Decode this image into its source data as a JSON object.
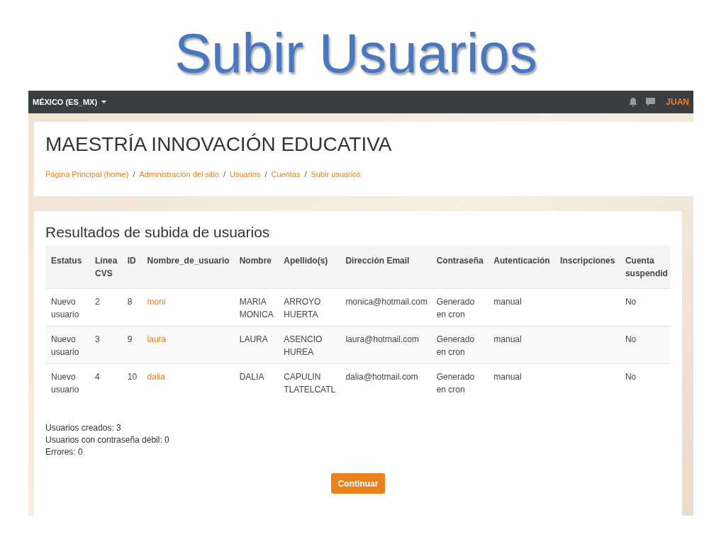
{
  "slide_title": "Subir Usuarios",
  "navbar": {
    "language": "MÉXICO (ES_MX)",
    "user": "JUAN"
  },
  "header": {
    "title": "MAESTRÍA INNOVACIÓN EDUCATIVA",
    "separator": "/",
    "breadcrumb": [
      "Página Principal (home)",
      "Administración del sitio",
      "Usuarios",
      "Cuentas",
      "Subir usuarios"
    ]
  },
  "results": {
    "heading": "Resultados de subida de usuarios",
    "columns": [
      {
        "label": "Estatus",
        "kind": "text"
      },
      {
        "label": "Línea CVS",
        "kind": "text"
      },
      {
        "label": "ID",
        "kind": "text"
      },
      {
        "label": "Nombre_de_usuario",
        "kind": "link"
      },
      {
        "label": "Nombre",
        "kind": "text"
      },
      {
        "label": "Apellido(s)",
        "kind": "text"
      },
      {
        "label": "Dirección Email",
        "kind": "text"
      },
      {
        "label": "Contraseña",
        "kind": "text"
      },
      {
        "label": "Autenticación",
        "kind": "text"
      },
      {
        "label": "Inscripciones",
        "kind": "text"
      },
      {
        "label": "Cuenta suspendid",
        "kind": "text"
      }
    ],
    "rows": [
      [
        "Nuevo usuario",
        "2",
        "8",
        "moni",
        "MARIA MONICA",
        "ARROYO HUERTA",
        "monica@hotmail.com",
        "Generado en cron",
        "manual",
        "",
        "No"
      ],
      [
        "Nuevo usuario",
        "3",
        "9",
        "laura",
        "LAURA",
        "ASENCIO HUREA",
        "laura@hotmail.com",
        "Generado en cron",
        "manual",
        "",
        "No"
      ],
      [
        "Nuevo usuario",
        "4",
        "10",
        "dalia",
        "DALIA",
        "CAPULIN TLATELCATL",
        "dalia@hotmail.com",
        "Generado en cron",
        "manual",
        "",
        "No"
      ]
    ]
  },
  "summary": [
    "Usuarios creados: 3",
    "Usuarios con contraseña débil: 0",
    "Errores: 0"
  ],
  "button": "Continuar"
}
